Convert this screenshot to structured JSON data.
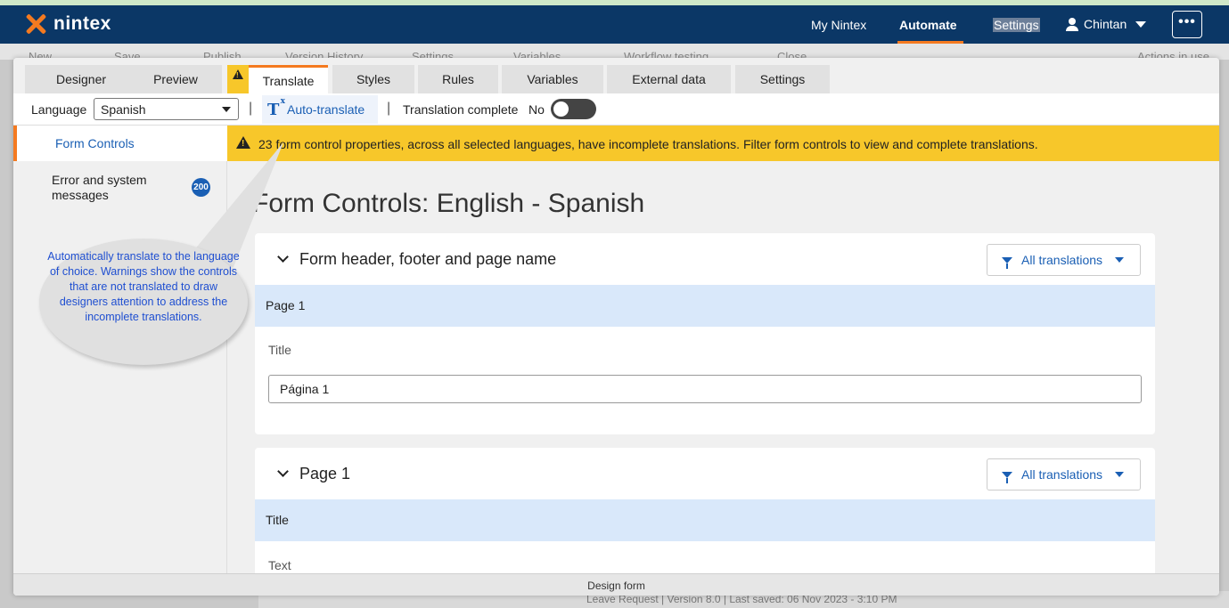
{
  "nav": {
    "logo_text": "nintex",
    "my_nintex": "My Nintex",
    "automate": "Automate",
    "settings": "Settings",
    "user": "Chintan",
    "more": "•••"
  },
  "background": {
    "toolbar_items": [
      "New",
      "Save",
      "Publish",
      "Version History",
      "Settings",
      "Variables",
      "Workflow testing",
      "Close",
      "Actions in use"
    ],
    "footer_text": "Leave Request  |  Version 8.0  |  Last saved: 06 Nov 2023 - 3:10 PM"
  },
  "tabs": [
    {
      "label": "Designer"
    },
    {
      "label": "Preview"
    },
    {
      "label": "Translate"
    },
    {
      "label": "Styles"
    },
    {
      "label": "Rules"
    },
    {
      "label": "Variables"
    },
    {
      "label": "External data"
    },
    {
      "label": "Settings"
    }
  ],
  "active_tab": "Translate",
  "langbar": {
    "language_label": "Language",
    "language_value": "Spanish",
    "auto_translate": "Auto-translate",
    "translation_complete_label": "Translation complete",
    "translation_complete_value": "No"
  },
  "sidebar": {
    "items": [
      {
        "label": "Form Controls"
      },
      {
        "label": "Error and system messages",
        "badge": "200"
      }
    ]
  },
  "warning": {
    "text": "23 form control properties, across all selected languages, have incomplete translations. Filter form controls to view and complete translations."
  },
  "main": {
    "title": "Form Controls: English - Spanish",
    "sections": [
      {
        "title": "Form header, footer and page name",
        "filter": "All translations",
        "row": "Page 1",
        "field_label": "Title",
        "field_value": "Página 1"
      },
      {
        "title": "Page 1",
        "filter": "All translations",
        "row": "Title",
        "field_label": "Text"
      }
    ]
  },
  "callout": {
    "text": "Automatically translate to the language of choice. Warnings show the controls that are not translated to draw designers attention to address the incomplete translations."
  },
  "modal_footer": "Design form",
  "colors": {
    "nav_bg": "#0b3766",
    "accent": "#f47a20",
    "warning": "#f7c72a",
    "link": "#1a5fb4",
    "highlight_row": "#d9e8fa"
  }
}
